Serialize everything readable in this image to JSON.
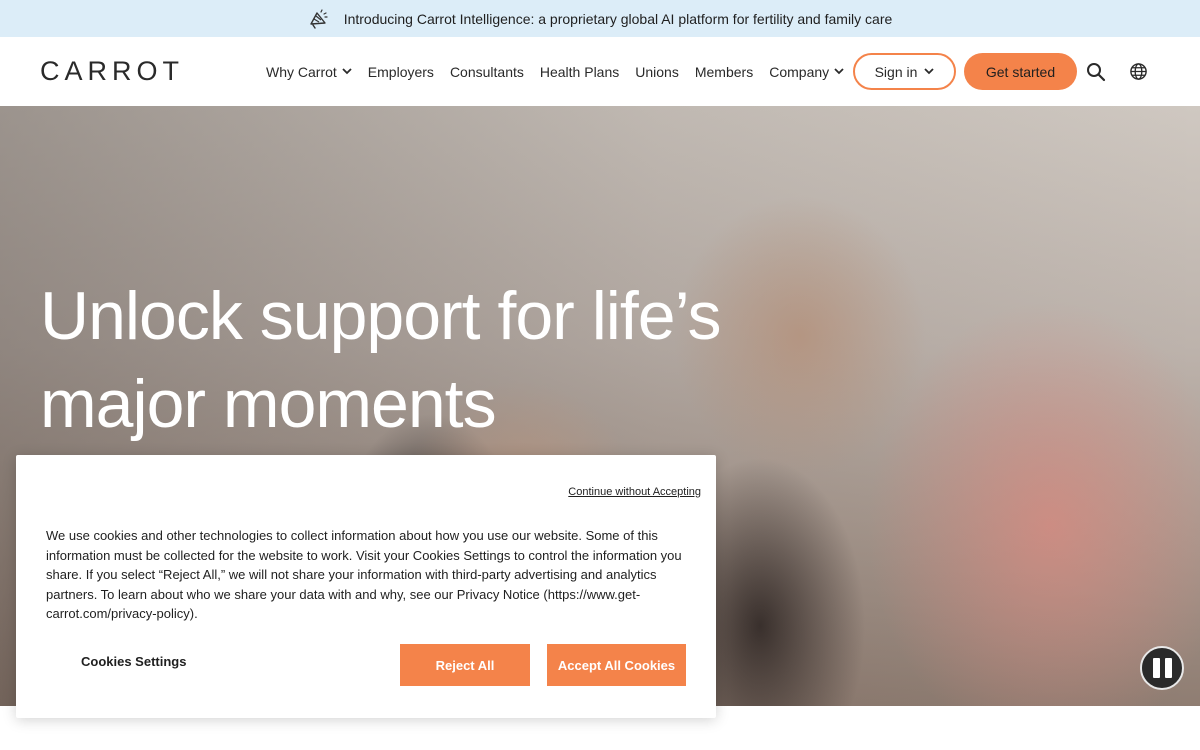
{
  "announcement": {
    "icon": "megaphone-icon",
    "text": "Introducing Carrot Intelligence: a proprietary global AI platform for fertility and family care"
  },
  "header": {
    "logo": "CARROT",
    "nav": [
      {
        "label": "Why Carrot",
        "has_dropdown": true
      },
      {
        "label": "Employers",
        "has_dropdown": false
      },
      {
        "label": "Consultants",
        "has_dropdown": false
      },
      {
        "label": "Health Plans",
        "has_dropdown": false
      },
      {
        "label": "Unions",
        "has_dropdown": false
      },
      {
        "label": "Members",
        "has_dropdown": false
      },
      {
        "label": "Company",
        "has_dropdown": true
      }
    ],
    "sign_in_label": "Sign in",
    "get_started_label": "Get started",
    "search_icon": "search-icon",
    "globe_icon": "globe-icon"
  },
  "hero": {
    "title_line1": "Unlock support for life’s",
    "title_line2": "major moments",
    "pause_icon": "pause-icon"
  },
  "cookie_banner": {
    "continue_link": "Continue without Accepting",
    "text": "We use cookies and other technologies to collect information about how you use our website. Some of this information must be collected for the website to work. Visit your Cookies Settings to control the information you share. If you select “Reject All,” we will not share your information with third-party advertising and analytics partners. To learn about who we share your data with and why, see our Privacy Notice (https://www.get-carrot.com/privacy-policy).",
    "settings_label": "Cookies Settings",
    "reject_label": "Reject All",
    "accept_label": "Accept All Cookies"
  },
  "colors": {
    "accent": "#f4834a",
    "banner_bg": "#dcedf8",
    "text": "#1f1f1f"
  }
}
